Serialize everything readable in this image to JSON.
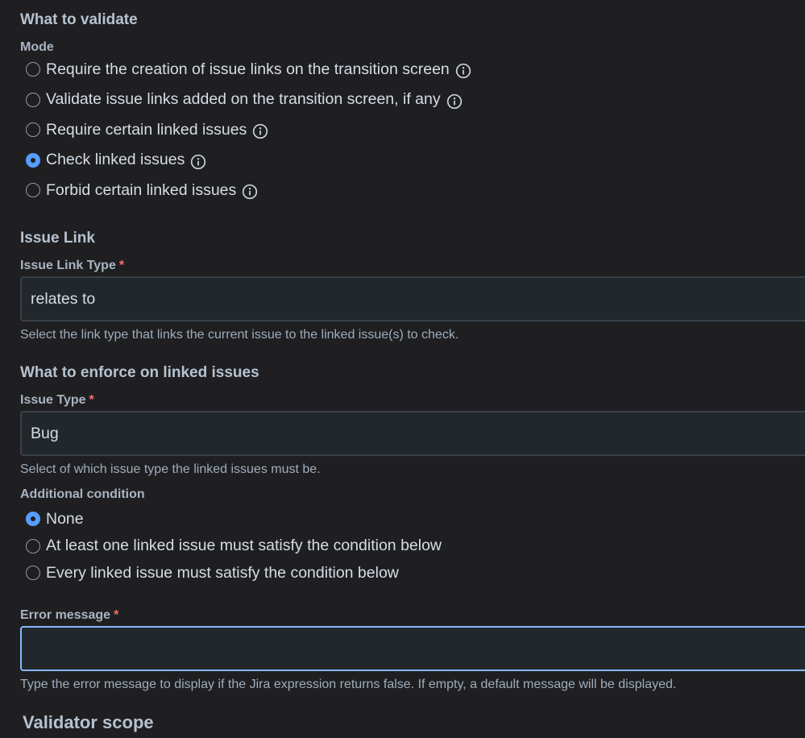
{
  "what_to_validate": {
    "heading": "What to validate",
    "mode_label": "Mode",
    "mode_options": [
      {
        "label": "Require the creation of issue links on the transition screen",
        "checked": false,
        "icon": "info-icon"
      },
      {
        "label": "Validate issue links added on the transition screen, if any",
        "checked": false,
        "icon": "info-icon"
      },
      {
        "label": "Require certain linked issues",
        "checked": false,
        "icon": "info-icon"
      },
      {
        "label": "Check linked issues",
        "checked": true,
        "icon": "info-icon"
      },
      {
        "label": "Forbid certain linked issues",
        "checked": false,
        "icon": "info-icon"
      }
    ]
  },
  "issue_link": {
    "heading": "Issue Link",
    "type_label": "Issue Link Type",
    "required_mark": "*",
    "type_value": "relates to",
    "help": "Select the link type that links the current issue to the linked issue(s) to check."
  },
  "enforce": {
    "heading": "What to enforce on linked issues",
    "issue_type_label": "Issue Type",
    "required_mark": "*",
    "issue_type_value": "Bug",
    "issue_type_help": "Select of which issue type the linked issues must be.",
    "additional_condition_label": "Additional condition",
    "condition_options": [
      {
        "label": "None",
        "checked": true
      },
      {
        "label": "At least one linked issue must satisfy the condition below",
        "checked": false
      },
      {
        "label": "Every linked issue must satisfy the condition below",
        "checked": false
      }
    ]
  },
  "error_message": {
    "label": "Error message",
    "required_mark": "*",
    "value": "",
    "help": "Type the error message to display if the Jira expression returns false. If empty, a default message will be displayed."
  },
  "validator_scope": {
    "heading": "Validator scope"
  },
  "colors": {
    "background": "#1f1f21",
    "accent": "#579dff",
    "required": "#f87168",
    "focus_border": "#85b8ff"
  }
}
